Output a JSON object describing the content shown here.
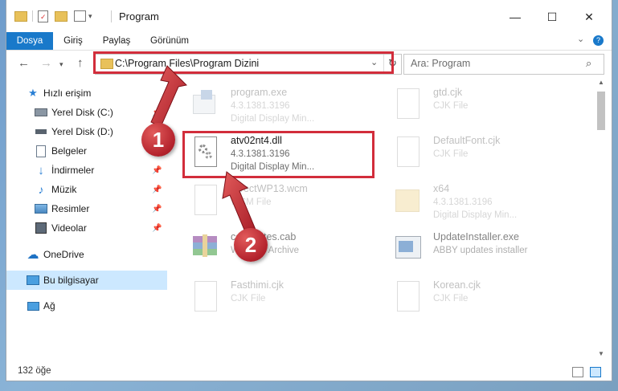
{
  "window": {
    "title": "Program",
    "minimize": "—",
    "maximize": "☐",
    "close": "✕"
  },
  "ribbon": {
    "tabs": [
      {
        "label": "Dosya"
      },
      {
        "label": "Giriş"
      },
      {
        "label": "Paylaş"
      },
      {
        "label": "Görünüm"
      }
    ]
  },
  "address": {
    "path": "C:\\Program Files\\Program Dizini",
    "search_placeholder": "Ara: Program"
  },
  "sidebar": {
    "items": [
      {
        "label": "Hızlı erişim",
        "icon": "star-icon"
      },
      {
        "label": "Yerel Disk (C:)",
        "icon": "drive-icon"
      },
      {
        "label": "Yerel Disk (D:)",
        "icon": "drive-icon"
      },
      {
        "label": "Belgeler",
        "icon": "documents-icon"
      },
      {
        "label": "İndirmeler",
        "icon": "download-icon"
      },
      {
        "label": "Müzik",
        "icon": "music-icon"
      },
      {
        "label": "Resimler",
        "icon": "pictures-icon"
      },
      {
        "label": "Videolar",
        "icon": "video-icon"
      },
      {
        "label": "OneDrive",
        "icon": "cloud-icon"
      },
      {
        "label": "Bu bilgisayar",
        "icon": "computer-icon"
      },
      {
        "label": "Ağ",
        "icon": "network-icon"
      }
    ]
  },
  "files": [
    {
      "name": "program.exe",
      "line2": "4.3.1381.3196",
      "line3": "Digital Display Min..."
    },
    {
      "name": "gtd.cjk",
      "line2": "CJK File",
      "line3": ""
    },
    {
      "name": "atv02nt4.dll",
      "line2": "4.3.1381.3196",
      "line3": "Digital Display Min..."
    },
    {
      "name": "DefaultFont.cjk",
      "line2": "CJK File",
      "line3": ""
    },
    {
      "name": "DirectWP13.wcm",
      "line2": "WCM File",
      "line3": ""
    },
    {
      "name": "x64",
      "line2": "4.3.1381.3196",
      "line3": "Digital Display Min..."
    },
    {
      "name": "coupdates.cab",
      "line2": "WinRAR Archive",
      "line3": ""
    },
    {
      "name": "UpdateInstaller.exe",
      "line2": "ABBY updates installer",
      "line3": ""
    },
    {
      "name": "Fasthimi.cjk",
      "line2": "CJK File",
      "line3": ""
    },
    {
      "name": "Korean.cjk",
      "line2": "CJK File",
      "line3": ""
    }
  ],
  "status": {
    "count": "132 öğe"
  },
  "annotations": {
    "step1": "1",
    "step2": "2",
    "color": "#d22d3b"
  }
}
